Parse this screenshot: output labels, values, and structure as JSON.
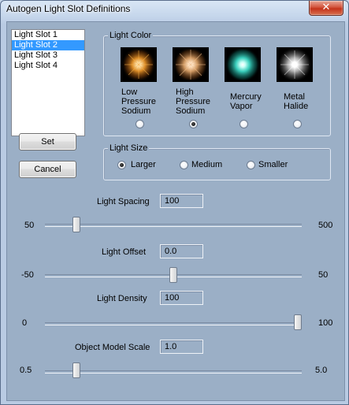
{
  "window": {
    "title": "Autogen Light Slot Definitions",
    "close_glyph": "✕"
  },
  "slots": {
    "items": [
      {
        "label": "Light Slot 1",
        "selected": false
      },
      {
        "label": "Light Slot 2",
        "selected": true
      },
      {
        "label": "Light Slot 3",
        "selected": false
      },
      {
        "label": "Light Slot 4",
        "selected": false
      }
    ]
  },
  "buttons": {
    "set": "Set",
    "cancel": "Cancel"
  },
  "light_color": {
    "title": "Light Color",
    "options": [
      {
        "lines": [
          "Low",
          "Pressure",
          "Sodium"
        ],
        "selected": false,
        "glow_color": "#f29a2a"
      },
      {
        "lines": [
          "High",
          "Pressure",
          "Sodium"
        ],
        "selected": true,
        "glow_color": "#f0b070"
      },
      {
        "lines": [
          "Mercury",
          "Vapor"
        ],
        "selected": false,
        "glow_color": "#3fe4cf"
      },
      {
        "lines": [
          "Metal",
          "Halide"
        ],
        "selected": false,
        "glow_color": "#f4f4f4"
      }
    ]
  },
  "light_size": {
    "title": "Light Size",
    "options": [
      {
        "label": "Larger",
        "selected": true
      },
      {
        "label": "Medium",
        "selected": false
      },
      {
        "label": "Smaller",
        "selected": false
      }
    ]
  },
  "sliders": [
    {
      "label": "Light Spacing",
      "value": "100",
      "min": "50",
      "max": "500",
      "position_fraction": 0.11
    },
    {
      "label": "Light Offset",
      "value": "0.0",
      "min": "-50",
      "max": "50",
      "position_fraction": 0.5
    },
    {
      "label": "Light Density",
      "value": "100",
      "min": "0",
      "max": "100",
      "position_fraction": 1.0
    },
    {
      "label": "Object Model Scale",
      "value": "1.0",
      "min": "0.5",
      "max": "5.0",
      "position_fraction": 0.11
    }
  ],
  "colors": {
    "window_bg": "#9bafc6",
    "selection": "#3399ff",
    "close_button": "#c4331b"
  }
}
